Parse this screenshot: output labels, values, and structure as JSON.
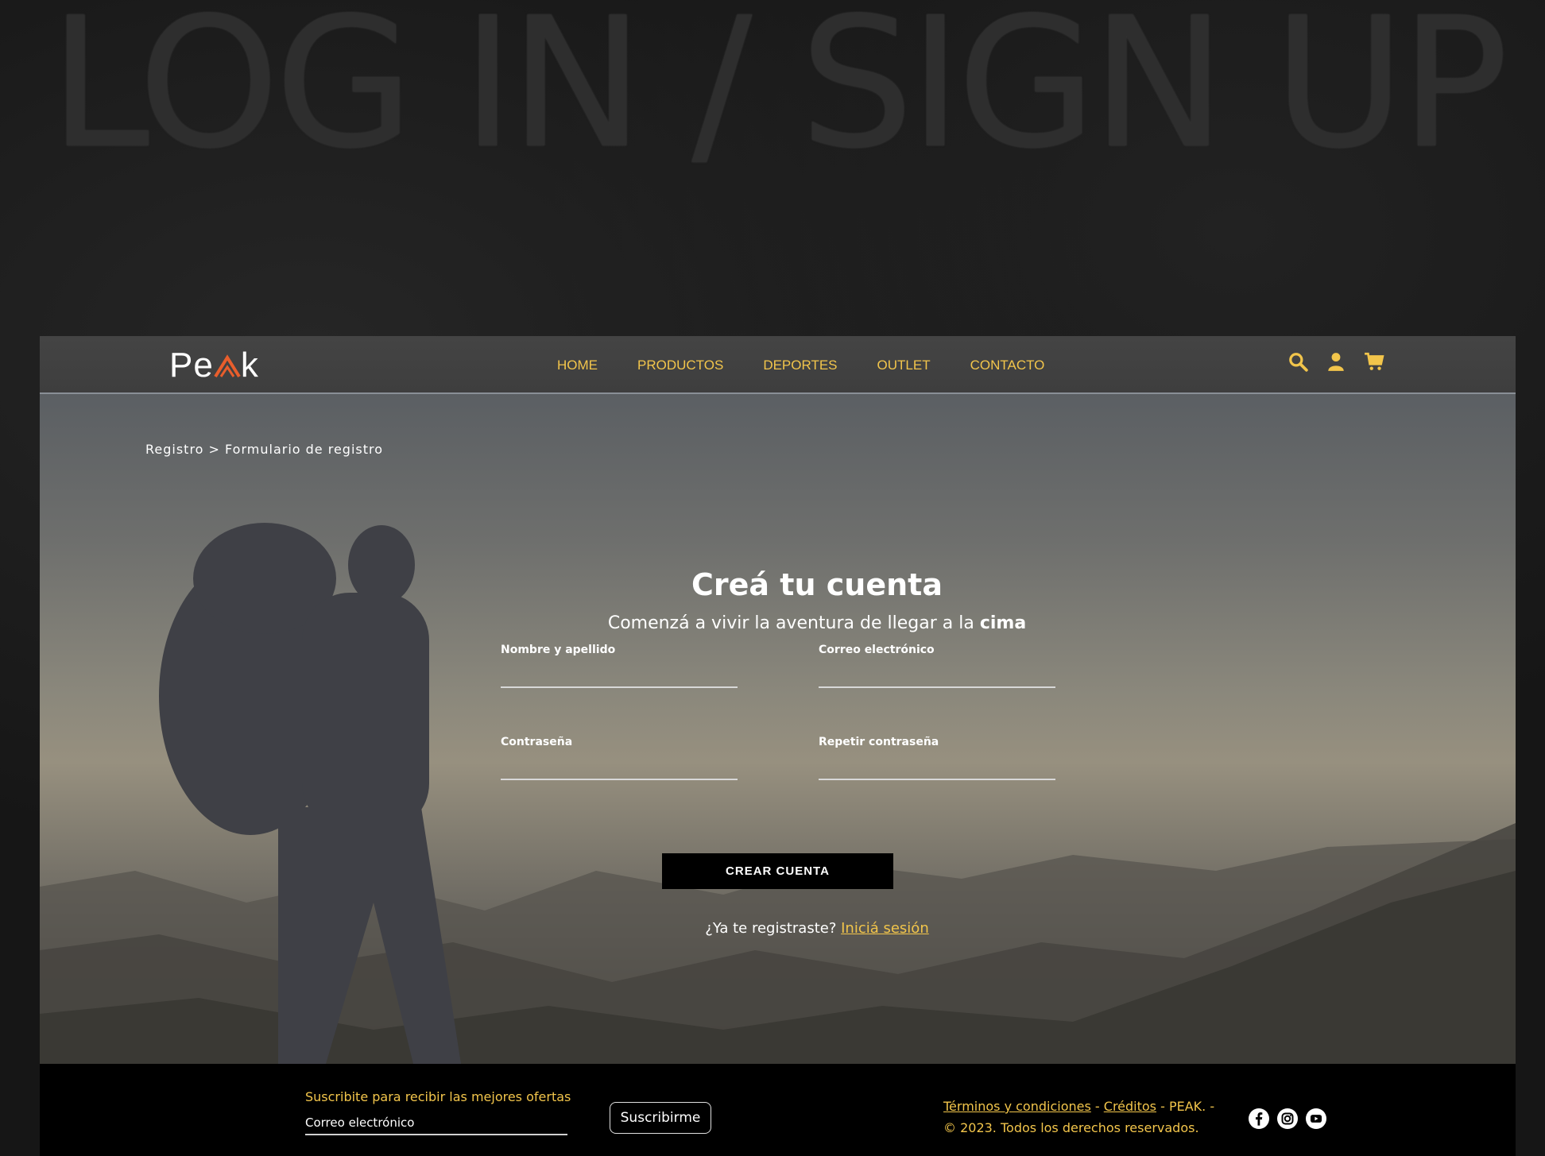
{
  "hero": {
    "title": "LOG IN / SIGN UP"
  },
  "logo": {
    "text_before": "Pe",
    "text_after": "k"
  },
  "nav": {
    "links": [
      "HOME",
      "PRODUCTOS",
      "DEPORTES",
      "OUTLET",
      "CONTACTO"
    ],
    "icons": [
      "search-icon",
      "user-icon",
      "cart-icon"
    ],
    "accent_color": "#f2c54b"
  },
  "breadcrumb": "Registro > Formulario de registro",
  "form": {
    "title": "Creá tu cuenta",
    "subtitle_text": "Comenzá a vivir la aventura de llegar a la ",
    "subtitle_bold": "cima",
    "fields": {
      "name": "Nombre y apellido",
      "email": "Correo electrónico",
      "password": "Contraseña",
      "repeat_password": "Repetir contraseña"
    },
    "submit_label": "CREAR CUENTA",
    "login_prompt": "¿Ya te registraste? ",
    "login_link": "Iniciá sesión"
  },
  "footer": {
    "subscribe_label": "Suscribite para recibir las mejores ofertas",
    "email_placeholder": "Correo electrónico",
    "subscribe_button": "Suscribirme",
    "terms_link": "Términos y condiciones",
    "separator": " - ",
    "credits_link": "Créditos",
    "brand_text": " - PEAK. -",
    "copyright": "© 2023. Todos los derechos reservados.",
    "social_icons": [
      "facebook-icon",
      "instagram-icon",
      "youtube-icon"
    ]
  }
}
